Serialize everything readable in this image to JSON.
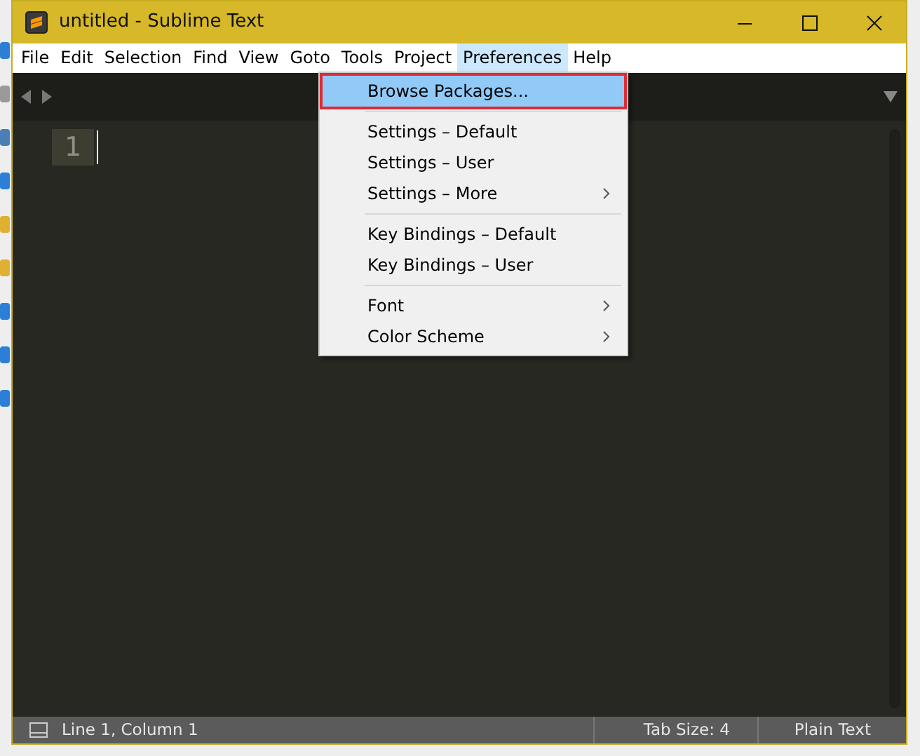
{
  "window": {
    "title": "untitled - Sublime Text"
  },
  "menu_bar": [
    {
      "label": "File",
      "selected": false
    },
    {
      "label": "Edit",
      "selected": false
    },
    {
      "label": "Selection",
      "selected": false
    },
    {
      "label": "Find",
      "selected": false
    },
    {
      "label": "View",
      "selected": false
    },
    {
      "label": "Goto",
      "selected": false
    },
    {
      "label": "Tools",
      "selected": false
    },
    {
      "label": "Project",
      "selected": false
    },
    {
      "label": "Preferences",
      "selected": true
    },
    {
      "label": "Help",
      "selected": false
    }
  ],
  "dropdown": [
    {
      "kind": "item",
      "label": "Browse Packages...",
      "selected": true,
      "submenu": false
    },
    {
      "kind": "separator"
    },
    {
      "kind": "item",
      "label": "Settings – Default",
      "selected": false,
      "submenu": false
    },
    {
      "kind": "item",
      "label": "Settings – User",
      "selected": false,
      "submenu": false
    },
    {
      "kind": "item",
      "label": "Settings – More",
      "selected": false,
      "submenu": true
    },
    {
      "kind": "separator"
    },
    {
      "kind": "item",
      "label": "Key Bindings – Default",
      "selected": false,
      "submenu": false
    },
    {
      "kind": "item",
      "label": "Key Bindings – User",
      "selected": false,
      "submenu": false
    },
    {
      "kind": "separator"
    },
    {
      "kind": "item",
      "label": "Font",
      "selected": false,
      "submenu": true
    },
    {
      "kind": "item",
      "label": "Color Scheme",
      "selected": false,
      "submenu": true
    }
  ],
  "editor": {
    "line_numbers": [
      "1"
    ]
  },
  "status_bar": {
    "position": "Line 1, Column 1",
    "tab_size": "Tab Size: 4",
    "syntax": "Plain Text"
  }
}
